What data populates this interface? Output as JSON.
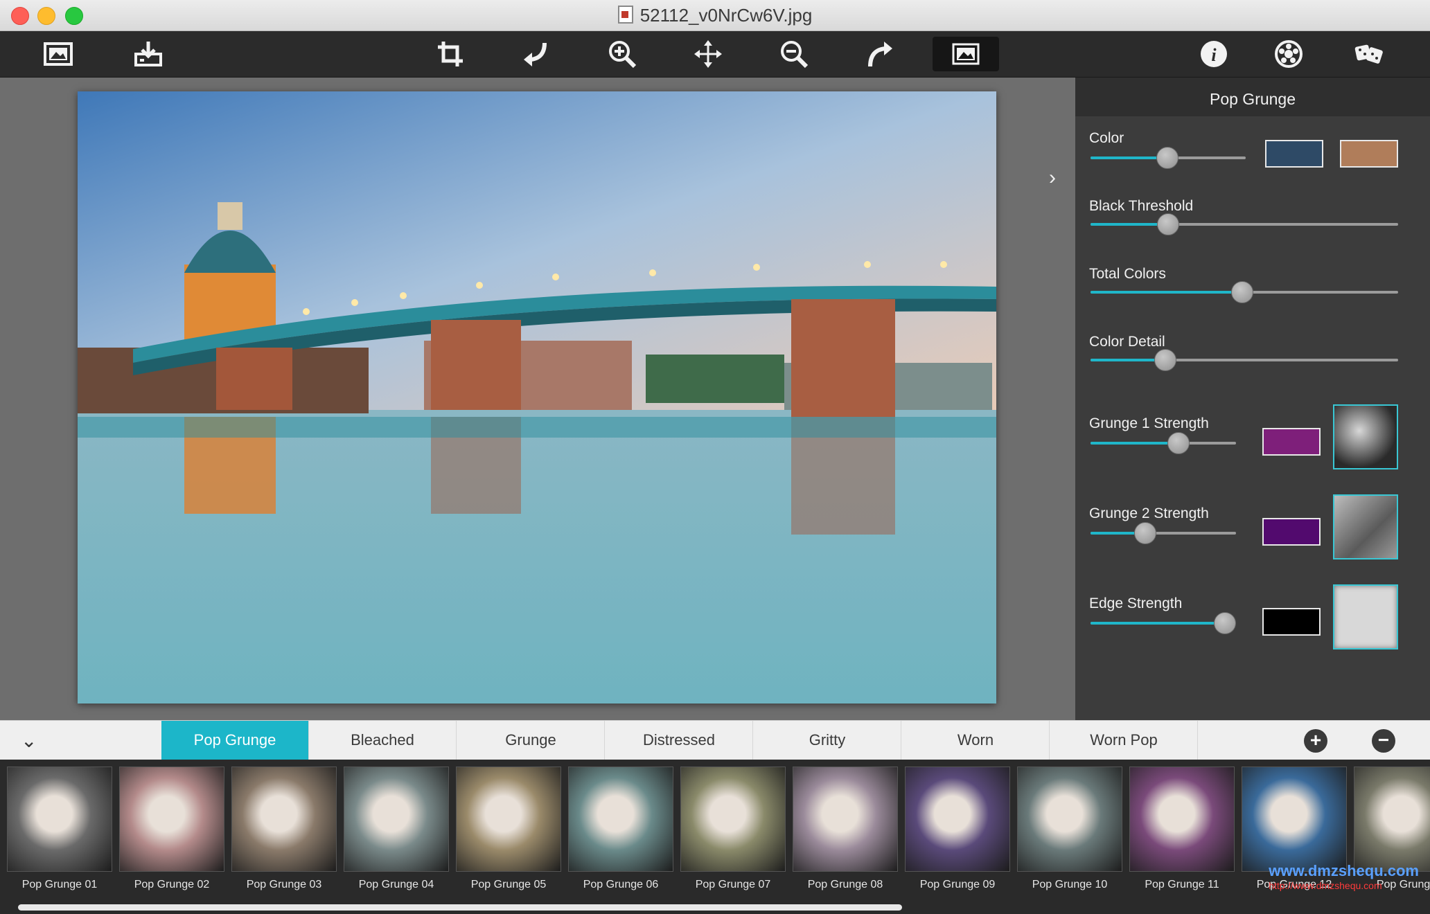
{
  "window": {
    "title": "52112_v0NrCw6V.jpg"
  },
  "toolbar": {
    "left": [
      "open-image-icon",
      "save-image-icon"
    ],
    "center": [
      "crop-icon",
      "undo-icon",
      "zoom-in-icon",
      "pan-icon",
      "zoom-out-icon",
      "redo-icon",
      "compare-image-icon"
    ],
    "right": [
      "info-icon",
      "settings-icon",
      "dice-random-icon"
    ]
  },
  "panel": {
    "title": "Pop Grunge",
    "controls": [
      {
        "label": "Color",
        "value": 0.49,
        "swatches": [
          "#2e4a66",
          "#b07d5a"
        ]
      },
      {
        "label": "Black Threshold",
        "value": 0.25
      },
      {
        "label": "Total Colors",
        "value": 0.49
      },
      {
        "label": "Color Detail",
        "value": 0.24
      },
      {
        "label": "Grunge 1 Strength",
        "value": 0.6,
        "swatch": "#7e1f7a",
        "texture": "grunge-texture-1"
      },
      {
        "label": "Grunge 2 Strength",
        "value": 0.37,
        "swatch": "#520a6e",
        "texture": "grunge-texture-2"
      },
      {
        "label": "Edge Strength",
        "value": 0.92,
        "swatch": "#000000",
        "texture": "edge-texture"
      }
    ]
  },
  "categories": {
    "items": [
      "Pop Grunge",
      "Bleached",
      "Grunge",
      "Distressed",
      "Gritty",
      "Worn",
      "Worn Pop"
    ],
    "active": "Pop Grunge"
  },
  "presets": [
    "Pop Grunge 01",
    "Pop Grunge 02",
    "Pop Grunge 03",
    "Pop Grunge 04",
    "Pop Grunge 05",
    "Pop Grunge 06",
    "Pop Grunge 07",
    "Pop Grunge 08",
    "Pop Grunge 09",
    "Pop Grunge 10",
    "Pop Grunge 11",
    "Pop Grunge 12",
    "Pop Grunge"
  ],
  "watermark": {
    "text": "www.dmzshequ.com",
    "url": "http://www.dmzshequ.com"
  },
  "colors": {
    "accent": "#1cb6c9",
    "toolbar": "#2b2b2b",
    "panel": "#3c3c3c"
  }
}
